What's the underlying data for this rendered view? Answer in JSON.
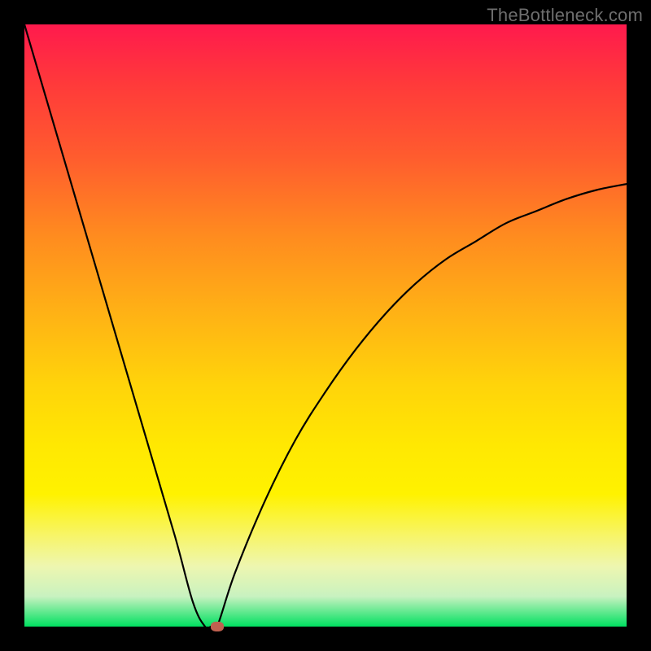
{
  "watermark": "TheBottleneck.com",
  "chart_data": {
    "type": "line",
    "title": "",
    "xlabel": "",
    "ylabel": "",
    "xlim": [
      0,
      1
    ],
    "ylim": [
      0,
      100
    ],
    "x": [
      0.0,
      0.05,
      0.1,
      0.15,
      0.2,
      0.25,
      0.28,
      0.3,
      0.31,
      0.32,
      0.35,
      0.4,
      0.45,
      0.5,
      0.55,
      0.6,
      0.65,
      0.7,
      0.75,
      0.8,
      0.85,
      0.9,
      0.95,
      1.0
    ],
    "values": [
      100,
      83,
      66,
      49,
      32,
      15,
      4,
      0,
      0,
      0,
      9,
      21,
      31,
      39,
      46,
      52,
      57,
      61,
      64,
      67,
      69,
      71,
      72.5,
      73.5
    ],
    "marker": {
      "x": 0.32,
      "y": 0
    },
    "background_gradient_top_color": "#ff1a4d",
    "background_gradient_bottom_color": "#00e060",
    "curve_color": "#000000",
    "marker_color": "#c06050"
  }
}
